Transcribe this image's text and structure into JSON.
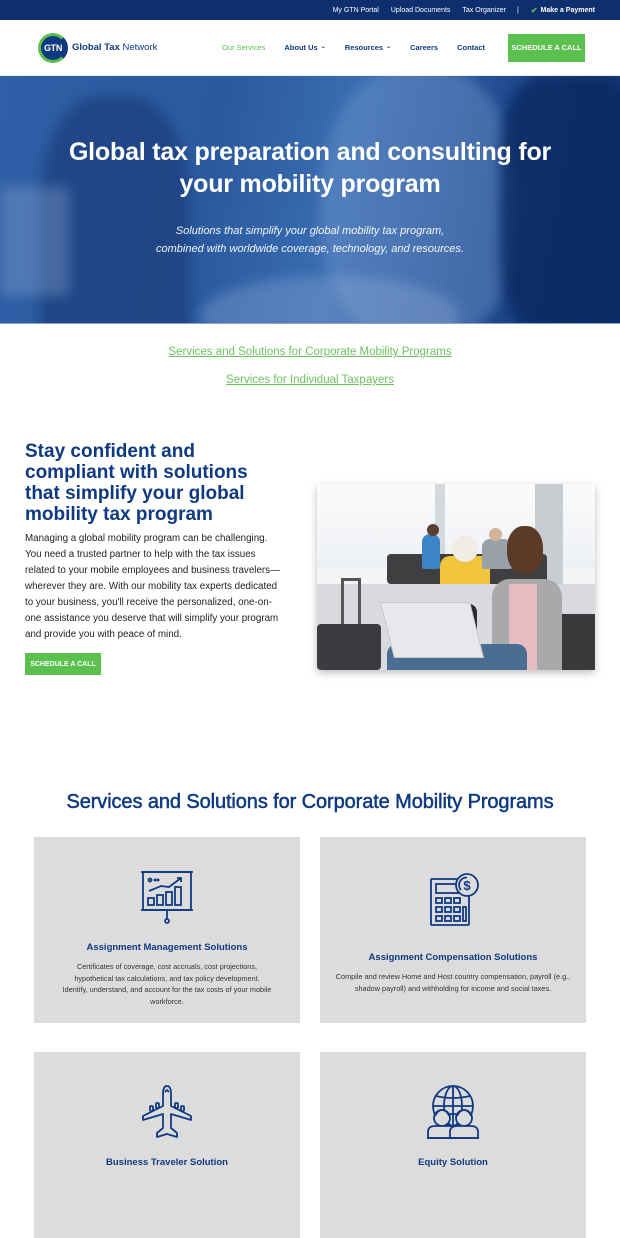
{
  "utility_bar": {
    "links": [
      "My GTN Portal",
      "Upload Documents",
      "Tax Organizer"
    ],
    "separator": "|",
    "payment_icon": "check-icon",
    "payment_label": "Make a Payment"
  },
  "header": {
    "logo_mark": "GTN",
    "logo_bold": "Global Tax",
    "logo_light": " Network",
    "nav": [
      {
        "label": "Our Services",
        "active": true
      },
      {
        "label": "About Us",
        "dropdown": true
      },
      {
        "label": "Resources",
        "dropdown": true
      },
      {
        "label": "Careers"
      },
      {
        "label": "Contact"
      }
    ],
    "chevron": "⌄",
    "cta_label": "SCHEDULE A CALL"
  },
  "hero": {
    "title_line1": "Global tax preparation and consulting for",
    "title_line2": "your mobility program",
    "subtitle_line1": "Solutions that simplify your global mobility tax program,",
    "subtitle_line2": "combined with worldwide coverage, technology, and resources."
  },
  "anchor_links": [
    "Services and Solutions for Corporate Mobility Programs",
    "Services for Individual Taxpayers"
  ],
  "intro": {
    "heading": "Stay confident and compliant with solutions that simplify your global mobility tax program",
    "body": "Managing a global mobility program can be challenging. You need a trusted partner to help with the tax issues related to your mobile employees and business travelers—wherever they are. With our mobility tax experts dedicated to your business, you'll receive the personalized, one-on-one assistance you deserve that will simplify your program and provide you with peace of mind.",
    "cta_label": "SCHEDULE A CALL",
    "photo_alt": "Traveler working on laptop in airport lounge"
  },
  "services": {
    "title": "Services and Solutions for Corporate Mobility Programs",
    "cards": [
      {
        "icon": "presentation-chart-icon",
        "title": "Assignment Management Solutions",
        "text": "Certificates of coverage, cost accruals, cost projections, hypothetical tax calculations, and tax policy development. Identify, understand, and account for the tax costs of your mobile workforce."
      },
      {
        "icon": "calculator-dollar-icon",
        "title": "Assignment Compensation Solutions",
        "text": "Compile and review Home and Host country compensation, payroll (e.g., shadow payroll) and withholding for income and social taxes."
      },
      {
        "icon": "airplane-icon",
        "title": "Business Traveler Solution",
        "text": ""
      },
      {
        "icon": "globe-people-icon",
        "title": "Equity Solution",
        "text": ""
      }
    ]
  },
  "colors": {
    "navy": "#0f3a82",
    "utility_bar": "#0e2f6e",
    "green": "#5cc04f",
    "card_bg": "#dcdcdc"
  }
}
